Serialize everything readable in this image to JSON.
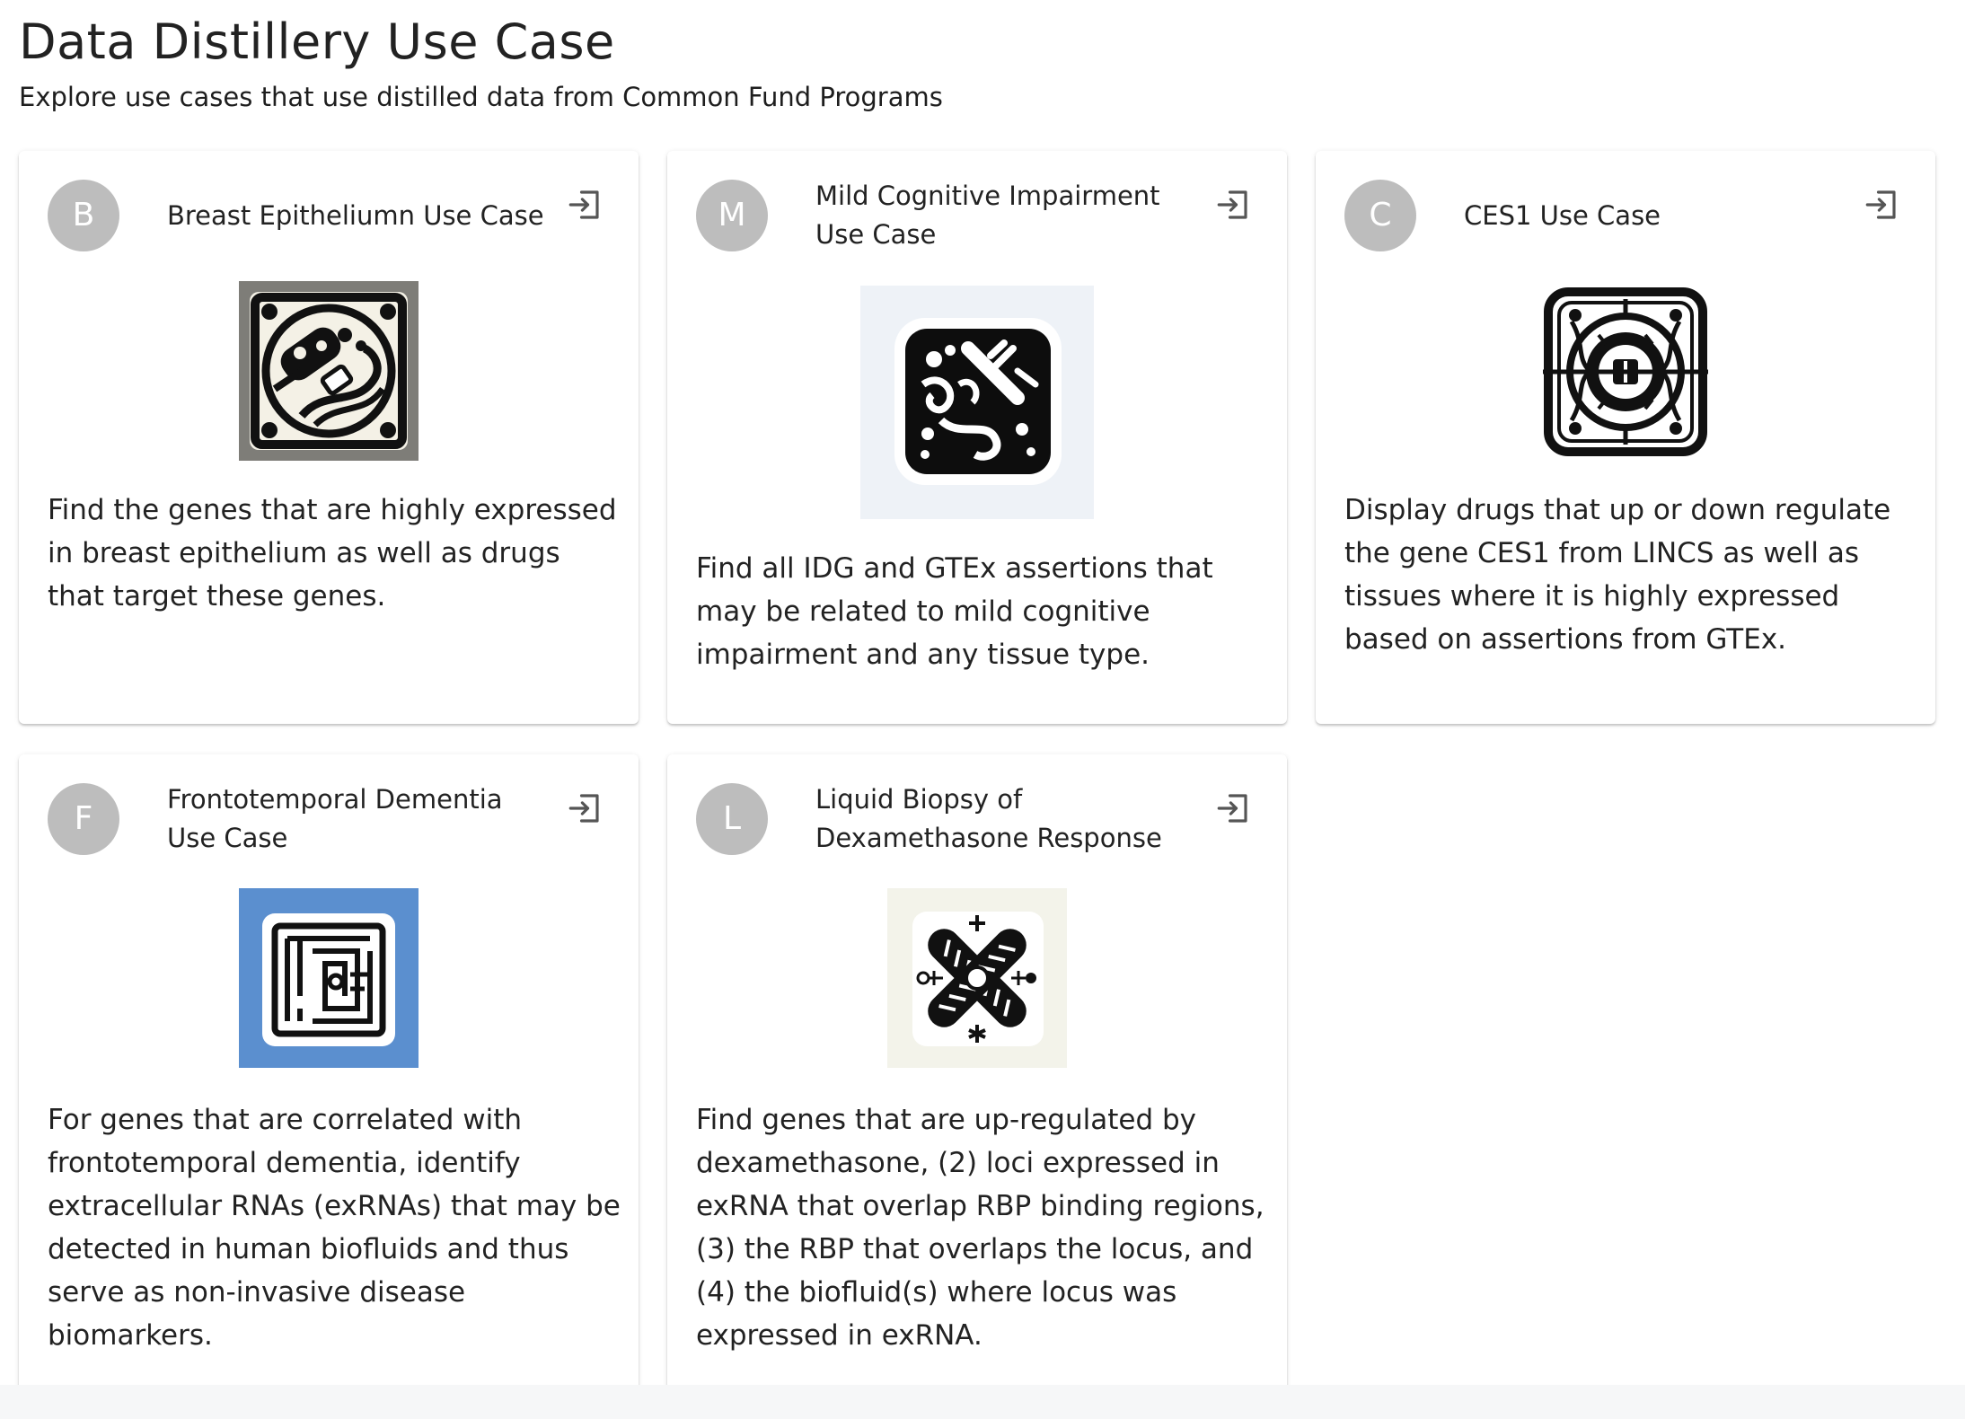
{
  "page": {
    "title": "Data Distillery Use Case",
    "subtitle": "Explore use cases that use distilled data from Common Fund Programs"
  },
  "cards": [
    {
      "avatar": "B",
      "title": "Breast Epitheliumn Use Case",
      "description": "Find the genes that are highly expressed in breast epithelium as well as drugs that target these genes.",
      "icon": "sign-in-icon",
      "image": "breast-epithelium-illustration"
    },
    {
      "avatar": "M",
      "title": "Mild Cognitive Impairment Use Case",
      "description": "Find all IDG and GTEx assertions that may be related to mild cognitive impairment and any tissue type.",
      "icon": "sign-in-icon",
      "image": "mild-cognitive-impairment-illustration"
    },
    {
      "avatar": "C",
      "title": "CES1 Use Case",
      "description": "Display drugs that up or down regulate the gene CES1 from LINCS as well as tissues where it is highly expressed based on assertions from GTEx.",
      "icon": "sign-in-icon",
      "image": "ces1-illustration"
    },
    {
      "avatar": "F",
      "title": "Frontotemporal Dementia Use Case",
      "description": "For genes that are correlated with frontotemporal dementia, identify extracellular RNAs (exRNAs) that may be detected in human biofluids and thus serve as non-invasive disease biomarkers.",
      "icon": "sign-in-icon",
      "image": "frontotemporal-dementia-illustration"
    },
    {
      "avatar": "L",
      "title": "Liquid Biopsy of Dexamethasone Response",
      "description": "Find genes that are up-regulated by dexamethasone, (2) loci expressed in exRNA that overlap RBP binding regions, (3) the RBP that overlaps the locus, and (4) the biofluid(s) where locus was expressed in exRNA.",
      "icon": "sign-in-icon",
      "image": "liquid-biopsy-illustration"
    }
  ],
  "colors": {
    "avatar": "#bdbdbd",
    "text": "#222222",
    "icon": "#555555"
  }
}
